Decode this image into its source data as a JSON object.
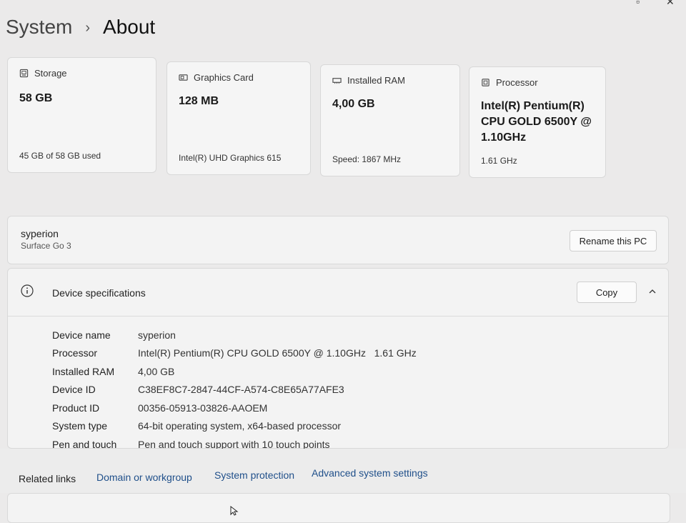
{
  "breadcrumb": {
    "parent": "System",
    "separator": "›",
    "current": "About"
  },
  "cards": {
    "storage": {
      "label": "Storage",
      "value": "58 GB",
      "detail": "45 GB of 58 GB used"
    },
    "graphics": {
      "label": "Graphics Card",
      "value": "128 MB",
      "detail": "Intel(R) UHD Graphics 615"
    },
    "ram": {
      "label": "Installed RAM",
      "value": "4,00 GB",
      "detail": "Speed: 1867 MHz"
    },
    "processor": {
      "label": "Processor",
      "value": "Intel(R) Pentium(R) CPU GOLD 6500Y @ 1.10GHz",
      "detail": "1.61 GHz"
    }
  },
  "pc": {
    "name": "syperion",
    "model": "Surface Go 3",
    "rename_label": "Rename this PC"
  },
  "device_specs": {
    "title": "Device specifications",
    "copy_label": "Copy",
    "rows": [
      {
        "label": "Device name",
        "value": "syperion"
      },
      {
        "label": "Processor",
        "value": "Intel(R) Pentium(R) CPU GOLD 6500Y @ 1.10GHz   1.61 GHz"
      },
      {
        "label": "Installed RAM",
        "value": "4,00 GB"
      },
      {
        "label": "Device ID",
        "value": "C38EF8C7-2847-44CF-A574-C8E65A77AFE3"
      },
      {
        "label": "Product ID",
        "value": "00356-05913-03826-AAOEM"
      },
      {
        "label": "System type",
        "value": "64-bit operating system, x64-based processor"
      },
      {
        "label": "Pen and touch",
        "value": "Pen and touch support with 10 touch points"
      }
    ]
  },
  "related": {
    "label": "Related links",
    "links": [
      "Domain or workgroup",
      "System protection",
      "Advanced system settings"
    ]
  }
}
